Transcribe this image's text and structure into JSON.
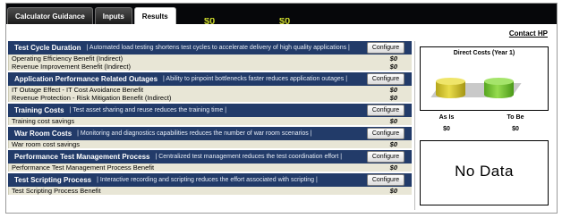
{
  "tabs": [
    {
      "label": "Calculator Guidance",
      "active": false
    },
    {
      "label": "Inputs",
      "active": false
    },
    {
      "label": "Results",
      "active": true
    }
  ],
  "header": {
    "ghost_values": [
      "$0",
      "$0"
    ],
    "contact_link": "Contact HP"
  },
  "configure_label": "Configure",
  "sections": [
    {
      "title": "Test Cycle Duration",
      "desc": "| Automated load testing shortens test cycles to accelerate delivery of high quality applications |",
      "items": [
        {
          "label": "Operating Efficiency Benefit (Indirect)",
          "value": "$0"
        },
        {
          "label": "Revenue Improvement Benefit (Indirect)",
          "value": "$0"
        }
      ]
    },
    {
      "title": "Application Performance Related Outages",
      "desc": "| Ability to pinpoint bottlenecks faster reduces application outages |",
      "items": [
        {
          "label": "IT Outage Effect - IT Cost Avoidance Benefit",
          "value": "$0"
        },
        {
          "label": "Revenue Protection - Risk Mitigation Benefit (Indirect)",
          "value": "$0"
        }
      ]
    },
    {
      "title": "Training Costs",
      "desc": "| Test asset sharing and reuse reduces the training time |",
      "items": [
        {
          "label": "Training cost savings",
          "value": "$0"
        }
      ]
    },
    {
      "title": "War Room Costs",
      "desc": "| Monitoring and diagnostics capabilities reduces the number of war room scenarios |",
      "items": [
        {
          "label": "War room cost savings",
          "value": "$0"
        }
      ]
    },
    {
      "title": "Performance Test Management Process",
      "desc": "| Centralized test management reduces the test coordination effort |",
      "items": [
        {
          "label": "Performance Test Management Process Benefit",
          "value": "$0"
        }
      ]
    },
    {
      "title": "Test Scripting Process",
      "desc": "| Interactive recording and scripting reduces the effort associated with scripting |",
      "items": [
        {
          "label": "Test Scripting Process Benefit",
          "value": "$0"
        }
      ]
    }
  ],
  "chart_data": {
    "type": "bar",
    "title": "Direct Costs (Year 1)",
    "categories": [
      "As Is",
      "To Be"
    ],
    "values": [
      0,
      0
    ],
    "colors": [
      "#d9cb35",
      "#7fc93a"
    ]
  },
  "summary": {
    "as_is_label": "As Is",
    "as_is_value": "$0",
    "to_be_label": "To Be",
    "to_be_value": "$0"
  },
  "no_data_text": "No Data"
}
